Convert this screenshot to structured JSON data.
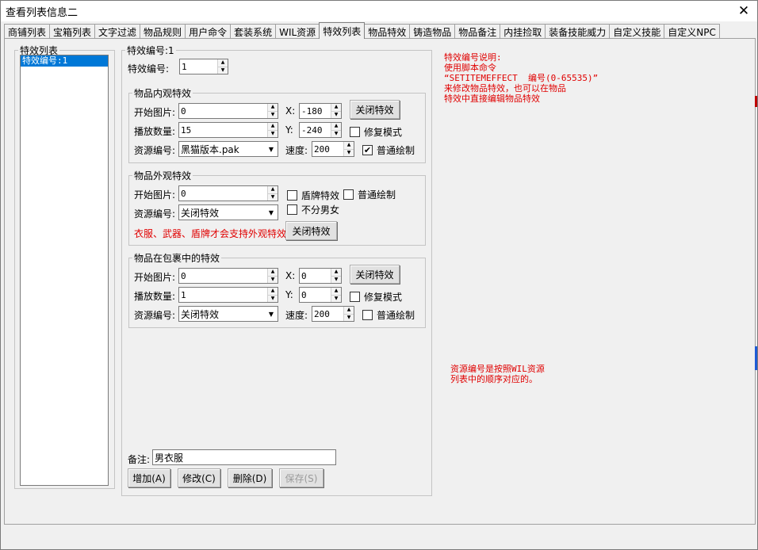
{
  "window": {
    "title": "查看列表信息二",
    "close_glyph": "✕"
  },
  "tabs": [
    {
      "label": "商铺列表"
    },
    {
      "label": "宝箱列表"
    },
    {
      "label": "文字过滤"
    },
    {
      "label": "物品规则"
    },
    {
      "label": "用户命令"
    },
    {
      "label": "套装系统"
    },
    {
      "label": "WIL资源"
    },
    {
      "label": "特效列表",
      "active": true
    },
    {
      "label": "物品特效"
    },
    {
      "label": "铸造物品"
    },
    {
      "label": "物品备注"
    },
    {
      "label": "内挂捡取"
    },
    {
      "label": "装备技能威力"
    },
    {
      "label": "自定义技能"
    },
    {
      "label": "自定义NPC"
    }
  ],
  "effect_list": {
    "legend": "特效列表",
    "items": [
      "特效编号:1"
    ]
  },
  "detail": {
    "legend": "特效编号:1",
    "effect_id_label": "特效编号:",
    "effect_id_value": "1",
    "inner": {
      "legend": "物品内观特效",
      "start_image_label": "开始图片:",
      "start_image_value": "0",
      "play_count_label": "播放数量:",
      "play_count_value": "15",
      "resource_label": "资源编号:",
      "resource_value": "黑猫版本.pak",
      "x_label": "X:",
      "x_value": "-180",
      "y_label": "Y:",
      "y_value": "-240",
      "speed_label": "速度:",
      "speed_value": "200",
      "close_effect_button": "关闭特效",
      "repair_mode_label": "修复模式",
      "repair_mode_checked": false,
      "normal_draw_label": "普通绘制",
      "normal_draw_checked": true
    },
    "outer": {
      "legend": "物品外观特效",
      "start_image_label": "开始图片:",
      "start_image_value": "0",
      "resource_label": "资源编号:",
      "resource_value": "关闭特效",
      "shield_effect_label": "盾牌特效",
      "shield_effect_checked": false,
      "normal_draw_label": "普通绘制",
      "normal_draw_checked": false,
      "unisex_label": "不分男女",
      "unisex_checked": false,
      "support_note": "衣服、武器、盾牌才会支持外观特效",
      "close_effect_button": "关闭特效"
    },
    "bag": {
      "legend": "物品在包裹中的特效",
      "start_image_label": "开始图片:",
      "start_image_value": "0",
      "play_count_label": "播放数量:",
      "play_count_value": "1",
      "resource_label": "资源编号:",
      "resource_value": "关闭特效",
      "x_label": "X:",
      "x_value": "0",
      "y_label": "Y:",
      "y_value": "0",
      "speed_label": "速度:",
      "speed_value": "200",
      "close_effect_button": "关闭特效",
      "repair_mode_label": "修复模式",
      "repair_mode_checked": false,
      "normal_draw_label": "普通绘制",
      "normal_draw_checked": false
    },
    "remark_label": "备注:",
    "remark_value": "男衣服",
    "buttons": {
      "add": "增加(A)",
      "modify": "修改(C)",
      "delete": "删除(D)",
      "save": "保存(S)"
    }
  },
  "notes": {
    "effect_help": "特效编号说明:\n使用脚本命令\n“SETITEMEFFECT  编号(0-65535)”\n来修改物品特效，也可以在物品\n特效中直接编辑物品特效",
    "resource_help": "资源编号是按照WIL资源\n列表中的顺序对应的。"
  },
  "colors": {
    "note_red": "#e00000",
    "selection_blue": "#0078d7"
  }
}
